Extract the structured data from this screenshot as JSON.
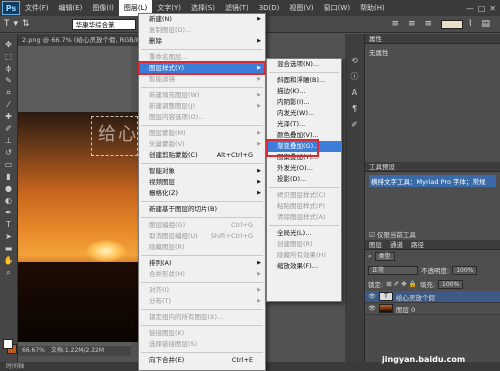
{
  "app": {
    "logo": "Ps",
    "window_controls": [
      "—",
      "□",
      "✕"
    ]
  },
  "menubar": {
    "items": [
      "文件(F)",
      "编辑(E)",
      "图像(I)",
      "图层(L)",
      "文字(Y)",
      "选择(S)",
      "滤镜(T)",
      "3D(D)",
      "视图(V)",
      "窗口(W)",
      "帮助(H)"
    ],
    "active_index": 3
  },
  "options_bar": {
    "tool_icon": "T",
    "font_value": "华康华综合篆"
  },
  "document": {
    "tab_title": "2.png @ 66.7% (给心灵放个假, RGB/8)",
    "zoom": "66.67%",
    "doc_size": "文档:1.22M/2.22M",
    "canvas_text": "给心"
  },
  "bottom_tab": {
    "label": "时间轴"
  },
  "layer_menu": {
    "items": [
      {
        "label": "新建(N)",
        "arrow": true
      },
      {
        "label": "复制图层(D)...",
        "disabled": true
      },
      {
        "label": "删除",
        "arrow": true
      },
      {
        "sep": true
      },
      {
        "label": "重命名图层...",
        "disabled": true
      },
      {
        "label": "图层样式(Y)",
        "arrow": true,
        "highlight": true
      },
      {
        "label": "智能滤镜",
        "disabled": true,
        "arrow": true
      },
      {
        "sep": true
      },
      {
        "label": "新建填充图层(W)",
        "arrow": true,
        "disabled": true
      },
      {
        "label": "新建调整图层(J)",
        "arrow": true,
        "disabled": true
      },
      {
        "label": "图层内容选项(O)...",
        "disabled": true
      },
      {
        "sep": true
      },
      {
        "label": "图层蒙版(M)",
        "arrow": true,
        "disabled": true
      },
      {
        "label": "矢量蒙版(V)",
        "arrow": true,
        "disabled": true
      },
      {
        "label": "创建剪贴蒙版(C)",
        "shortcut": "Alt+Ctrl+G"
      },
      {
        "sep": true
      },
      {
        "label": "智能对象",
        "arrow": true
      },
      {
        "label": "视频图层",
        "arrow": true
      },
      {
        "label": "栅格化(Z)",
        "arrow": true
      },
      {
        "sep": true
      },
      {
        "label": "新建基于图层的切片(B)"
      },
      {
        "sep": true
      },
      {
        "label": "图层编组(G)",
        "shortcut": "Ctrl+G",
        "disabled": true
      },
      {
        "label": "取消图层编组(U)",
        "shortcut": "Shift+Ctrl+G",
        "disabled": true
      },
      {
        "label": "隐藏图层(R)",
        "disabled": true
      },
      {
        "sep": true
      },
      {
        "label": "排列(A)",
        "arrow": true
      },
      {
        "label": "合并形状(H)",
        "arrow": true,
        "disabled": true
      },
      {
        "sep": true
      },
      {
        "label": "对齐(I)",
        "arrow": true,
        "disabled": true
      },
      {
        "label": "分布(T)",
        "arrow": true,
        "disabled": true
      },
      {
        "sep": true
      },
      {
        "label": "锁定组内的所有图层(X)...",
        "disabled": true
      },
      {
        "sep": true
      },
      {
        "label": "链接图层(K)",
        "disabled": true
      },
      {
        "label": "选择链接图层(S)",
        "disabled": true
      },
      {
        "sep": true
      },
      {
        "label": "向下合并(E)",
        "shortcut": "Ctrl+E"
      }
    ]
  },
  "style_submenu": {
    "items": [
      {
        "label": "混合选项(N)..."
      },
      {
        "sep": true
      },
      {
        "label": "斜面和浮雕(B)..."
      },
      {
        "label": "描边(K)..."
      },
      {
        "label": "内阴影(I)..."
      },
      {
        "label": "内发光(W)..."
      },
      {
        "label": "光泽(T)..."
      },
      {
        "label": "颜色叠加(V)..."
      },
      {
        "label": "渐变叠加(G)...",
        "highlight": true
      },
      {
        "label": "图案叠加(Y)..."
      },
      {
        "label": "外发光(O)..."
      },
      {
        "label": "投影(D)..."
      },
      {
        "sep": true
      },
      {
        "label": "拷贝图层样式(C)",
        "disabled": true
      },
      {
        "label": "粘贴图层样式(P)",
        "disabled": true
      },
      {
        "label": "清除图层样式(A)",
        "disabled": true
      },
      {
        "sep": true
      },
      {
        "label": "全局光(L)..."
      },
      {
        "label": "创建图层(R)",
        "disabled": true
      },
      {
        "label": "隐藏所有效果(H)",
        "disabled": true
      },
      {
        "label": "缩放效果(F)..."
      }
    ]
  },
  "right_panel": {
    "properties": {
      "title": "属性",
      "body": "无属性"
    },
    "tool_preset": {
      "title": "工具预设",
      "body": "横排文字工具：Myriad Pro 字体；常规"
    },
    "current_tool_only": "仅限当前工具",
    "layers": {
      "tabs": [
        "图层",
        "通道",
        "路径"
      ],
      "kind_label": "类型",
      "blend_mode": "正常",
      "opacity_label": "不透明度:",
      "opacity_value": "100%",
      "lock_label": "锁定:",
      "fill_label": "填充:",
      "fill_value": "100%",
      "rows": [
        {
          "name": "给心灵放个假",
          "type": "T",
          "selected": true
        },
        {
          "name": "图层 0",
          "type": "img",
          "selected": false
        }
      ]
    }
  },
  "watermark": "jingyan.baidu.com"
}
